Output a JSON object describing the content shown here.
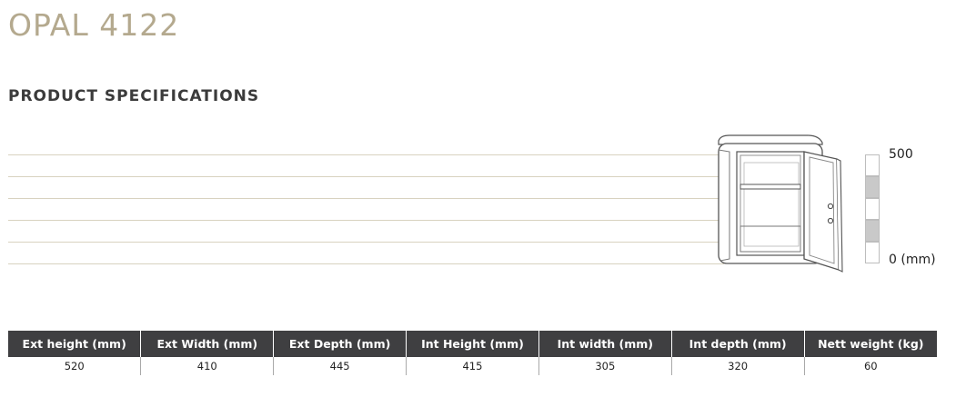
{
  "product": {
    "title": "OPAL 4122"
  },
  "section": {
    "title": "PRODUCT SPECIFICATIONS"
  },
  "scale": {
    "top_label": "500",
    "bottom_label": "0 (mm)"
  },
  "illustration": {
    "icon": "safe-open-door-icon",
    "line_color": "#555555",
    "accent_color": "#b4a98e"
  },
  "specs": {
    "headers": [
      "Ext height (mm)",
      "Ext Width (mm)",
      "Ext Depth (mm)",
      "Int Height (mm)",
      "Int width (mm)",
      "Int depth (mm)",
      "Nett weight (kg)"
    ],
    "values": [
      "520",
      "410",
      "445",
      "415",
      "305",
      "320",
      "60"
    ],
    "header_bg": "#3f3f41"
  }
}
